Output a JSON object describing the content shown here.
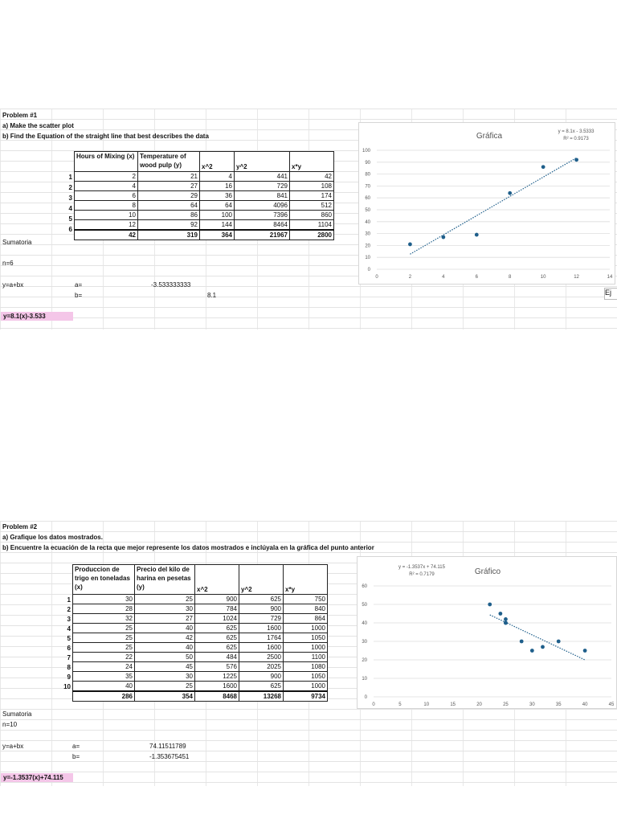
{
  "problem1": {
    "title": "Problem #1",
    "line_a": "a) Make the scatter plot",
    "line_b": "b) Find the Equation of the straight line that best describes the data",
    "headers": {
      "x": "Hours of Mixing (x)",
      "y": "Temperature of wood pulp (y)",
      "x2": "x^2",
      "y2": "y^2",
      "xy": "x*y"
    },
    "rows": [
      {
        "i": "1",
        "x": "2",
        "y": "21",
        "x2": "4",
        "y2": "441",
        "xy": "42"
      },
      {
        "i": "2",
        "x": "4",
        "y": "27",
        "x2": "16",
        "y2": "729",
        "xy": "108"
      },
      {
        "i": "3",
        "x": "6",
        "y": "29",
        "x2": "36",
        "y2": "841",
        "xy": "174"
      },
      {
        "i": "4",
        "x": "8",
        "y": "64",
        "x2": "64",
        "y2": "4096",
        "xy": "512"
      },
      {
        "i": "5",
        "x": "10",
        "y": "86",
        "x2": "100",
        "y2": "7396",
        "xy": "860"
      },
      {
        "i": "6",
        "x": "12",
        "y": "92",
        "x2": "144",
        "y2": "8464",
        "xy": "1104"
      }
    ],
    "sum_label": "Sumatoria",
    "sums": {
      "x": "42",
      "y": "319",
      "x2": "364",
      "y2": "21967",
      "xy": "2800"
    },
    "n_label": "n=6",
    "model_label": "y=a+bx",
    "a_label": "a=",
    "a_value": "-3.533333333",
    "b_label": "b=",
    "b_value": "8.1",
    "result": "y=8.1(x)-3.533",
    "side_label": "Ej"
  },
  "problem2": {
    "title": "Problem #2",
    "line_a": "a) Grafique los datos mostrados.",
    "line_b": "b) Encuentre la ecuación de la recta que mejor represente los datos mostrados e inclúyala en la gráfica del punto anterior",
    "headers": {
      "x": "Produccion de trigo en toneladas (x)",
      "y": "Precio del kilo de harina en pesetas (y)",
      "x2": "x^2",
      "y2": "y^2",
      "xy": "x*y"
    },
    "rows": [
      {
        "i": "1",
        "x": "30",
        "y": "25",
        "x2": "900",
        "y2": "625",
        "xy": "750"
      },
      {
        "i": "2",
        "x": "28",
        "y": "30",
        "x2": "784",
        "y2": "900",
        "xy": "840"
      },
      {
        "i": "3",
        "x": "32",
        "y": "27",
        "x2": "1024",
        "y2": "729",
        "xy": "864"
      },
      {
        "i": "4",
        "x": "25",
        "y": "40",
        "x2": "625",
        "y2": "1600",
        "xy": "1000"
      },
      {
        "i": "5",
        "x": "25",
        "y": "42",
        "x2": "625",
        "y2": "1764",
        "xy": "1050"
      },
      {
        "i": "6",
        "x": "25",
        "y": "40",
        "x2": "625",
        "y2": "1600",
        "xy": "1000"
      },
      {
        "i": "7",
        "x": "22",
        "y": "50",
        "x2": "484",
        "y2": "2500",
        "xy": "1100"
      },
      {
        "i": "8",
        "x": "24",
        "y": "45",
        "x2": "576",
        "y2": "2025",
        "xy": "1080"
      },
      {
        "i": "9",
        "x": "35",
        "y": "30",
        "x2": "1225",
        "y2": "900",
        "xy": "1050"
      },
      {
        "i": "10",
        "x": "40",
        "y": "25",
        "x2": "1600",
        "y2": "625",
        "xy": "1000"
      }
    ],
    "sum_label": "Sumatoria",
    "sums": {
      "x": "286",
      "y": "354",
      "x2": "8468",
      "y2": "13268",
      "xy": "9734"
    },
    "n_label": "n=10",
    "model_label": "y=a+bx",
    "a_label": "a=",
    "a_value": "74.11511789",
    "b_label": "b=",
    "b_value": "-1.353675451",
    "result": "y=-1.3537(x)+74.115"
  },
  "chart_data": [
    {
      "type": "scatter",
      "title": "Gráfica",
      "equation": "y = 8.1x - 3.5333",
      "r2": "R² = 0.9173",
      "x": [
        2,
        4,
        6,
        8,
        10,
        12
      ],
      "y": [
        21,
        27,
        29,
        64,
        86,
        92
      ],
      "trendline": {
        "slope": 8.1,
        "intercept": -3.5333
      },
      "xlim": [
        0,
        14
      ],
      "ylim": [
        0,
        100
      ],
      "xticks": [
        "0",
        "2",
        "4",
        "6",
        "8",
        "10",
        "12",
        "14"
      ],
      "yticks": [
        "0",
        "10",
        "20",
        "30",
        "40",
        "50",
        "60",
        "70",
        "80",
        "90",
        "100"
      ],
      "grid": true,
      "point_color": "#1f5f8b"
    },
    {
      "type": "scatter",
      "title": "Gráfico",
      "equation": "y = -1.3537x + 74.115",
      "r2": "R² = 0.7179",
      "x": [
        30,
        28,
        32,
        25,
        25,
        25,
        22,
        24,
        35,
        40
      ],
      "y": [
        25,
        30,
        27,
        40,
        42,
        40,
        50,
        45,
        30,
        25
      ],
      "trendline": {
        "slope": -1.3537,
        "intercept": 74.115
      },
      "xlim": [
        0,
        45
      ],
      "ylim": [
        0,
        60
      ],
      "xticks": [
        "0",
        "5",
        "10",
        "15",
        "20",
        "25",
        "30",
        "35",
        "40",
        "45"
      ],
      "yticks": [
        "0",
        "10",
        "20",
        "30",
        "40",
        "50",
        "60"
      ],
      "grid": true,
      "point_color": "#1f5f8b"
    }
  ]
}
